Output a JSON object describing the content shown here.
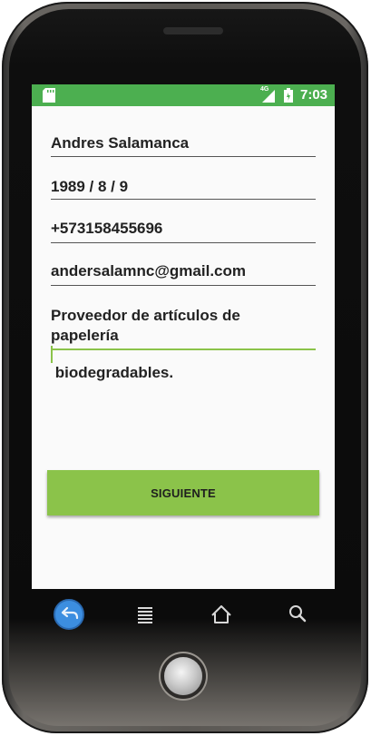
{
  "status_bar": {
    "network_label": "4G",
    "time": "7:03",
    "background_color": "#4caf50",
    "icons": [
      "sd-card-icon",
      "signal-icon",
      "battery-icon"
    ]
  },
  "form": {
    "fields": [
      {
        "name": "name",
        "value": "Andres Salamanca"
      },
      {
        "name": "birthdate",
        "value": "1989 / 8 / 9"
      },
      {
        "name": "phone",
        "value": "+573158455696"
      },
      {
        "name": "email",
        "value": "andersalamnc@gmail.com"
      },
      {
        "name": "description",
        "value_line1": "Proveedor de artículos de",
        "value_line2_before_cursor": "papelería",
        "value_line2_after_cursor": " biodegradables.",
        "focused": true
      }
    ],
    "submit_label": "SIGUIENTE",
    "accent_color": "#8bc34a"
  },
  "nav_bar": {
    "buttons": [
      "back-icon",
      "menu-icon",
      "home-icon",
      "search-icon"
    ]
  }
}
